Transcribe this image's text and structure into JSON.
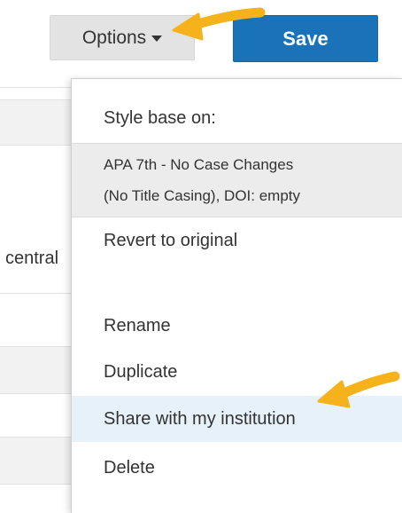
{
  "toolbar": {
    "options_label": "Options",
    "save_label": "Save"
  },
  "background": {
    "partial_text": "central"
  },
  "menu": {
    "header": "Style base on:",
    "style_line_1": "APA 7th - No Case Changes",
    "style_line_2": "(No Title Casing), DOI: empty",
    "items": [
      {
        "label": "Revert to original"
      },
      {
        "label": "Rename"
      },
      {
        "label": "Duplicate"
      },
      {
        "label": "Share with my institution"
      },
      {
        "label": "Delete"
      }
    ]
  },
  "colors": {
    "save_button": "#1a73b8",
    "options_button": "#e3e3e3",
    "highlight_row": "#e6f1fa",
    "arrow": "#f5b21b"
  },
  "icons": {
    "options_caret": "caret-down-icon",
    "annotation": "arrow-icon"
  }
}
